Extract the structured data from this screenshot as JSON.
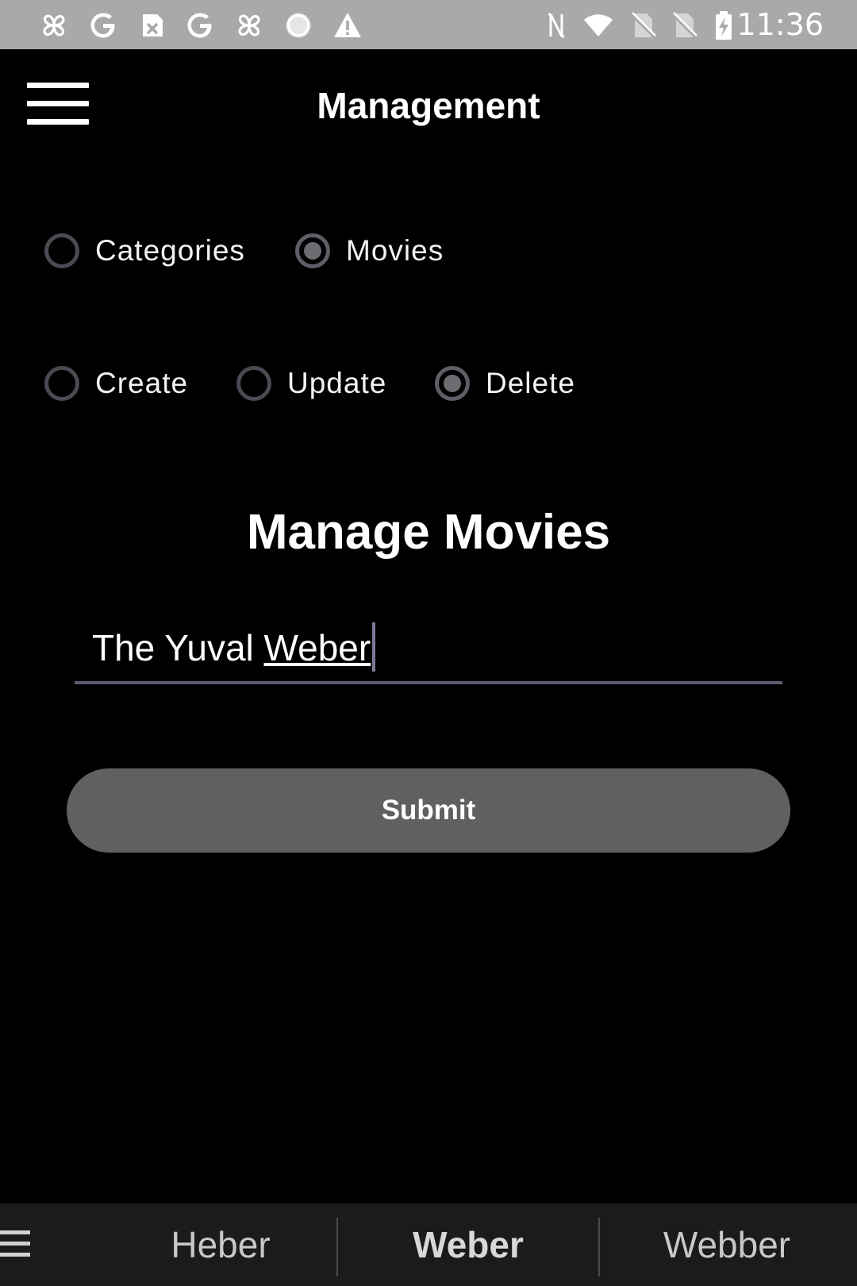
{
  "status_bar": {
    "time": "11:36",
    "left_icons": [
      "pinwheel-icon",
      "google-icon",
      "image-off-icon",
      "google-icon",
      "pinwheel-icon",
      "loading-icon",
      "warning-icon"
    ],
    "right_icons": [
      "nfc-icon",
      "wifi-icon",
      "no-sim-icon",
      "no-sim-icon",
      "battery-charging-icon"
    ]
  },
  "app_bar": {
    "title": "Management"
  },
  "entity_group": {
    "options": [
      {
        "label": "Categories",
        "checked": false
      },
      {
        "label": "Movies",
        "checked": true
      }
    ]
  },
  "action_group": {
    "options": [
      {
        "label": "Create",
        "checked": false
      },
      {
        "label": "Update",
        "checked": false
      },
      {
        "label": "Delete",
        "checked": true
      }
    ]
  },
  "main": {
    "section_title": "Manage Movies",
    "input_prefix": "The Yuval ",
    "input_underlined": "Weber",
    "submit_label": "Submit"
  },
  "keyboard_suggestions": {
    "items": [
      "Heber",
      "Weber",
      "Webber"
    ],
    "selected": "Weber"
  },
  "colors": {
    "background": "#000000",
    "status_bar": "#a9a9a9",
    "button": "#606060",
    "input_underline": "#5a5a72",
    "suggestion_bar": "#1b1b1b"
  }
}
